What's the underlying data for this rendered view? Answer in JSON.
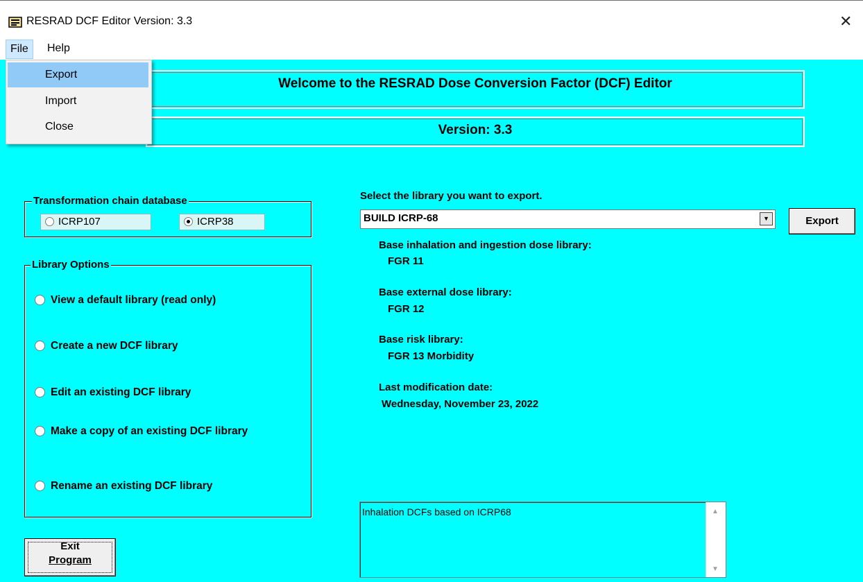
{
  "window": {
    "title": "RESRAD DCF Editor Version: 3.3",
    "close_glyph": "✕"
  },
  "menubar": {
    "file": "File",
    "help": "Help"
  },
  "file_menu": {
    "items": [
      "Export",
      "Import",
      "Close"
    ],
    "highlighted": "Export"
  },
  "banner": {
    "welcome": "Welcome to the RESRAD Dose Conversion Factor (DCF) Editor",
    "version": "Version: 3.3"
  },
  "chain_db": {
    "label": "Transformation chain database",
    "options": [
      "ICRP107",
      "ICRP38"
    ],
    "selected": "ICRP38"
  },
  "library_options": {
    "label": "Library Options",
    "items": [
      "View a default library (read only)",
      "Create a new DCF library",
      "Edit an existing DCF library",
      "Make a copy of an existing DCF library",
      "Rename an existing DCF library"
    ]
  },
  "export_panel": {
    "prompt": "Select the library you want to export.",
    "selected_library": "BUILD ICRP-68",
    "export_button": "Export",
    "base_inhalation_label": "Base inhalation and ingestion dose library:",
    "base_inhalation_value": "FGR 11",
    "base_external_label": "Base external dose library:",
    "base_external_value": "FGR 12",
    "base_risk_label": "Base risk library:",
    "base_risk_value": "FGR 13 Morbidity",
    "last_mod_label": "Last modification date:",
    "last_mod_value": "Wednesday, November 23, 2022",
    "description": "Inhalation DCFs based on ICRP68"
  },
  "exit_button": {
    "line1": "Exit",
    "line2": "Program"
  },
  "colors": {
    "background": "#00ffff",
    "menu_highlight": "#91c9f7"
  }
}
